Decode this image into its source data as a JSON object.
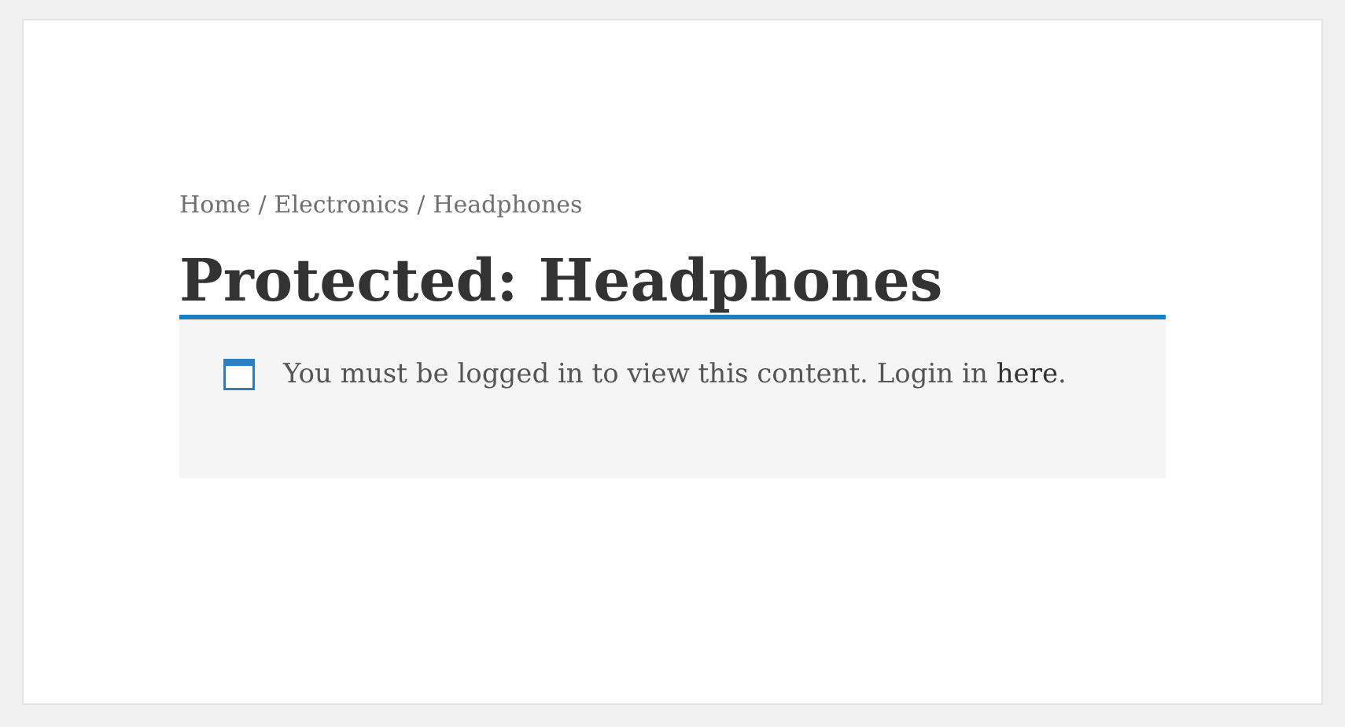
{
  "breadcrumb": [
    "Home",
    "/",
    "Electronics",
    "/",
    "Headphones"
  ],
  "title": "Protected: Headphones",
  "notice": {
    "text": "You must be logged in to view this content. Login in ",
    "link": "here",
    "after": "."
  }
}
